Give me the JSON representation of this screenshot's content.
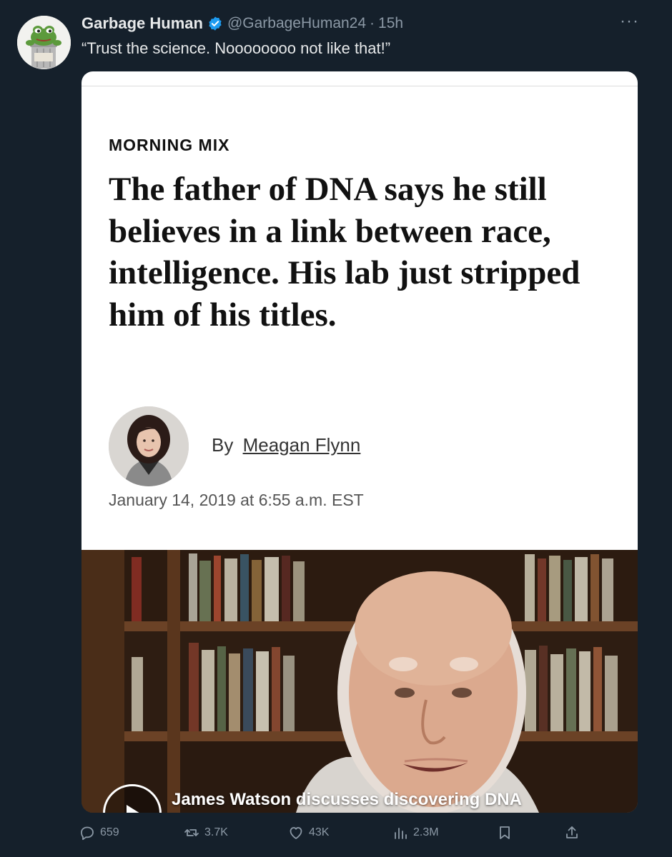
{
  "tweet": {
    "display_name": "Garbage Human",
    "handle": "@GarbageHuman24",
    "separator": "·",
    "time": "15h",
    "more": "···",
    "text": "“Trust the science. Noooooooo not like that!”",
    "avatar": {
      "icon": "frog-in-trash-can",
      "can_label_line1": "GARBAGE",
      "can_label_line2": "HUMAN"
    }
  },
  "article": {
    "kicker": "MORNING MIX",
    "headline": "The father of DNA says he still believes in a link between race, intelligence. His lab just stripped him of his titles.",
    "byline_prefix": "By",
    "author": "Meagan Flynn",
    "date": "January 14, 2019 at 6:55 a.m. EST",
    "video_caption": "James Watson discusses discovering DNA"
  },
  "actions": {
    "replies": "659",
    "retweets": "3.7K",
    "likes": "43K",
    "views": "2.3M"
  },
  "colors": {
    "background": "#15202b",
    "text_primary": "#e7e9ea",
    "text_secondary": "#8b98a5",
    "verified": "#1d9bf0",
    "card_bg": "#ffffff"
  }
}
